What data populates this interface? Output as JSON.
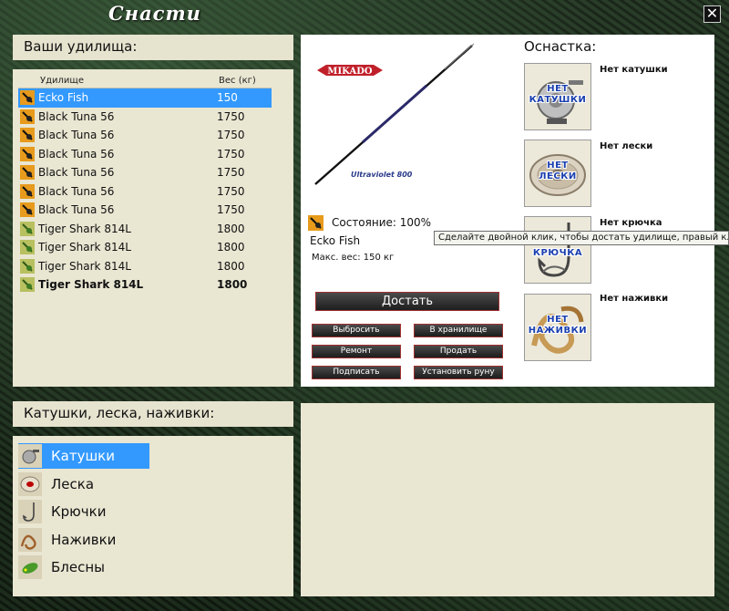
{
  "window": {
    "title": "Снасти",
    "close_label": "✕"
  },
  "rods_section": {
    "header": "Ваши удилища:",
    "col_name": "Удилище",
    "col_weight": "Вес (кг)",
    "rows": [
      {
        "name": "Ecko Fish",
        "weight": "150",
        "icon": "rod-orange-icon",
        "selected": true,
        "bold": false
      },
      {
        "name": "Black Tuna 56",
        "weight": "1750",
        "icon": "rod-orange-icon",
        "selected": false,
        "bold": false
      },
      {
        "name": "Black Tuna 56",
        "weight": "1750",
        "icon": "rod-orange-icon",
        "selected": false,
        "bold": false
      },
      {
        "name": "Black Tuna 56",
        "weight": "1750",
        "icon": "rod-orange-icon",
        "selected": false,
        "bold": false
      },
      {
        "name": "Black Tuna 56",
        "weight": "1750",
        "icon": "rod-orange-icon",
        "selected": false,
        "bold": false
      },
      {
        "name": "Black Tuna 56",
        "weight": "1750",
        "icon": "rod-orange-icon",
        "selected": false,
        "bold": false
      },
      {
        "name": "Black Tuna 56",
        "weight": "1750",
        "icon": "rod-orange-icon",
        "selected": false,
        "bold": false
      },
      {
        "name": "Tiger Shark 814L",
        "weight": "1800",
        "icon": "rod-green-icon",
        "selected": false,
        "bold": false
      },
      {
        "name": "Tiger Shark 814L",
        "weight": "1800",
        "icon": "rod-green-icon",
        "selected": false,
        "bold": false
      },
      {
        "name": "Tiger Shark 814L",
        "weight": "1800",
        "icon": "rod-green-icon",
        "selected": false,
        "bold": false
      },
      {
        "name": "Tiger Shark 814L",
        "weight": "1800",
        "icon": "rod-green-icon",
        "selected": false,
        "bold": true
      }
    ]
  },
  "detail": {
    "brand": "MIKADO",
    "model_caption": "Ultraviolet 800",
    "state_text": "Состояние: 100%",
    "rod_name": "Ecko Fish",
    "max_weight": "Макс. вес: 150 кг",
    "main_button": "Достать",
    "buttons": {
      "discard": "Выбросить",
      "to_storage": "В хранилище",
      "repair": "Ремонт",
      "sell": "Продать",
      "sign": "Подписать",
      "set_rune": "Установить руну"
    },
    "rigging_title": "Оснастка:",
    "slots": [
      {
        "key": "reel",
        "overlay_l1": "НЕТ",
        "overlay_l2": "КАТУШКИ",
        "label": "Нет катушки"
      },
      {
        "key": "line",
        "overlay_l1": "НЕТ",
        "overlay_l2": "ЛЕСКИ",
        "label": "Нет лески"
      },
      {
        "key": "hook",
        "overlay_l1": "НЕТ",
        "overlay_l2": "КРЮЧКА",
        "label": "Нет крючка"
      },
      {
        "key": "bait",
        "overlay_l1": "НЕТ",
        "overlay_l2": "НАЖИВКИ",
        "label": "Нет наживки"
      }
    ]
  },
  "tooltip": "Сделайте двойной клик, чтобы достать удилище, правый клик",
  "categories_section": {
    "header": "Катушки, леска, наживки:",
    "items": [
      {
        "label": "Катушки",
        "icon": "reel-icon",
        "selected": true
      },
      {
        "label": "Леска",
        "icon": "line-spool-icon",
        "selected": false
      },
      {
        "label": "Крючки",
        "icon": "hook-icon",
        "selected": false
      },
      {
        "label": "Наживки",
        "icon": "bait-icon",
        "selected": false
      },
      {
        "label": "Блесны",
        "icon": "lure-icon",
        "selected": false
      }
    ]
  },
  "colors": {
    "selection": "#3399ff",
    "panel": "#e6e3cf",
    "slot_text": "#1a3fb0"
  }
}
